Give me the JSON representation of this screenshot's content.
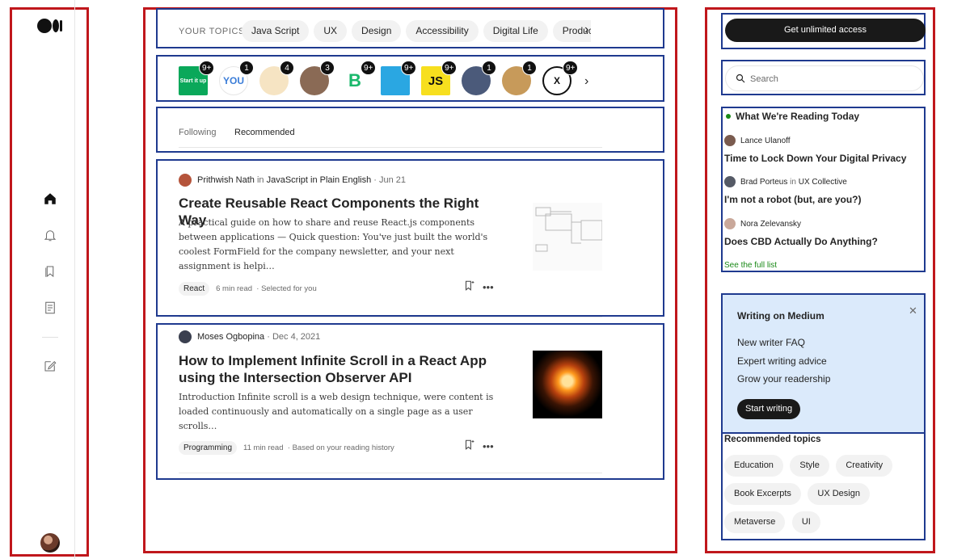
{
  "brand": {
    "logo": "medium-logo"
  },
  "left_rail": {
    "icons": [
      "home-icon",
      "bell-icon",
      "bookmarks-icon",
      "stories-icon",
      "write-icon"
    ]
  },
  "topics": {
    "label": "YOUR TOPICS",
    "items": [
      "Java Script",
      "UX",
      "Design",
      "Accessibility",
      "Digital Life",
      "Productivity"
    ]
  },
  "publications": [
    {
      "name": "Start it up",
      "text": "Start it up",
      "badge": "9+",
      "bg": "#0aa85a",
      "fg": "#ffffff"
    },
    {
      "name": "YOU",
      "text": "YOU",
      "badge": "1",
      "bg": "#ffffff",
      "fg": "#3b7dd8"
    },
    {
      "name": "dog-pixel",
      "text": "",
      "badge": "4",
      "bg": "#f6e4c3",
      "fg": "#111111"
    },
    {
      "name": "person-1",
      "text": "",
      "badge": "3",
      "bg": "#8a6a55",
      "fg": "#ffffff"
    },
    {
      "name": "B-pub",
      "text": "B",
      "badge": "9+",
      "bg": "#ffffff",
      "fg": "#19b86b"
    },
    {
      "name": "polar-pub",
      "text": "",
      "badge": "9+",
      "bg": "#2aa7e2",
      "fg": "#ffffff"
    },
    {
      "name": "JS",
      "text": "JS",
      "badge": "9+",
      "bg": "#f7df1e",
      "fg": "#111111"
    },
    {
      "name": "person-2",
      "text": "",
      "badge": "1",
      "bg": "#4b5a7a",
      "fg": "#ffffff"
    },
    {
      "name": "person-3",
      "text": "",
      "badge": "1",
      "bg": "#c79a5a",
      "fg": "#ffffff"
    },
    {
      "name": "X-pub",
      "text": "X",
      "badge": "9+",
      "bg": "#ffffff",
      "fg": "#111111"
    }
  ],
  "feed_tabs": [
    "Following",
    "Recommended"
  ],
  "articles": [
    {
      "author": "Prithwish Nath",
      "in": "in",
      "publication": "JavaScript in Plain English",
      "date": "· Jun 21",
      "title": "Create Reusable React Components the Right Way",
      "excerpt": "A practical guide on how to share and reuse React.js components between applications — Quick question: You've just built the world's coolest FormField for the company newsletter, and your next assignment is helpi…",
      "tag": "React",
      "read_time": "6 min read",
      "reason": "· Selected for you"
    },
    {
      "author": "Moses Ogbopina",
      "in": "",
      "publication": "",
      "date": "· Dec 4, 2021",
      "title": "How to Implement Infinite Scroll in a React App using the Intersection Observer API",
      "excerpt": "Introduction Infinite scroll is a web design technique, were content is loaded continuously and automatically on a single page as a user scrolls…",
      "tag": "Programming",
      "read_time": "11 min read",
      "reason": "· Based on your reading history"
    }
  ],
  "sidebar": {
    "access_button": "Get unlimited access",
    "search_placeholder": "Search",
    "reading": {
      "heading": "What We're Reading Today",
      "items": [
        {
          "author": "Lance Ulanoff",
          "in": "",
          "publication": "",
          "title": "Time to Lock Down Your Digital Privacy"
        },
        {
          "author": "Brad Porteus",
          "in": "in",
          "publication": "UX Collective",
          "title": "I'm not a robot (but, are you?)"
        },
        {
          "author": "Nora Zelevansky",
          "in": "",
          "publication": "",
          "title": "Does CBD Actually Do Anything?"
        }
      ],
      "see_full": "See the full list"
    },
    "writing": {
      "title": "Writing on Medium",
      "links": [
        "New writer FAQ",
        "Expert writing advice",
        "Grow your readership"
      ],
      "button": "Start writing"
    },
    "recommended": {
      "title": "Recommended topics",
      "items": [
        "Education",
        "Style",
        "Creativity",
        "Book Excerpts",
        "UX Design",
        "Metaverse",
        "UI"
      ]
    }
  },
  "colors": {
    "annotation_red": "#c0171c",
    "annotation_blue": "#1f3a8f",
    "accent_green": "#1a8917",
    "writing_bg": "#dbeafb"
  }
}
